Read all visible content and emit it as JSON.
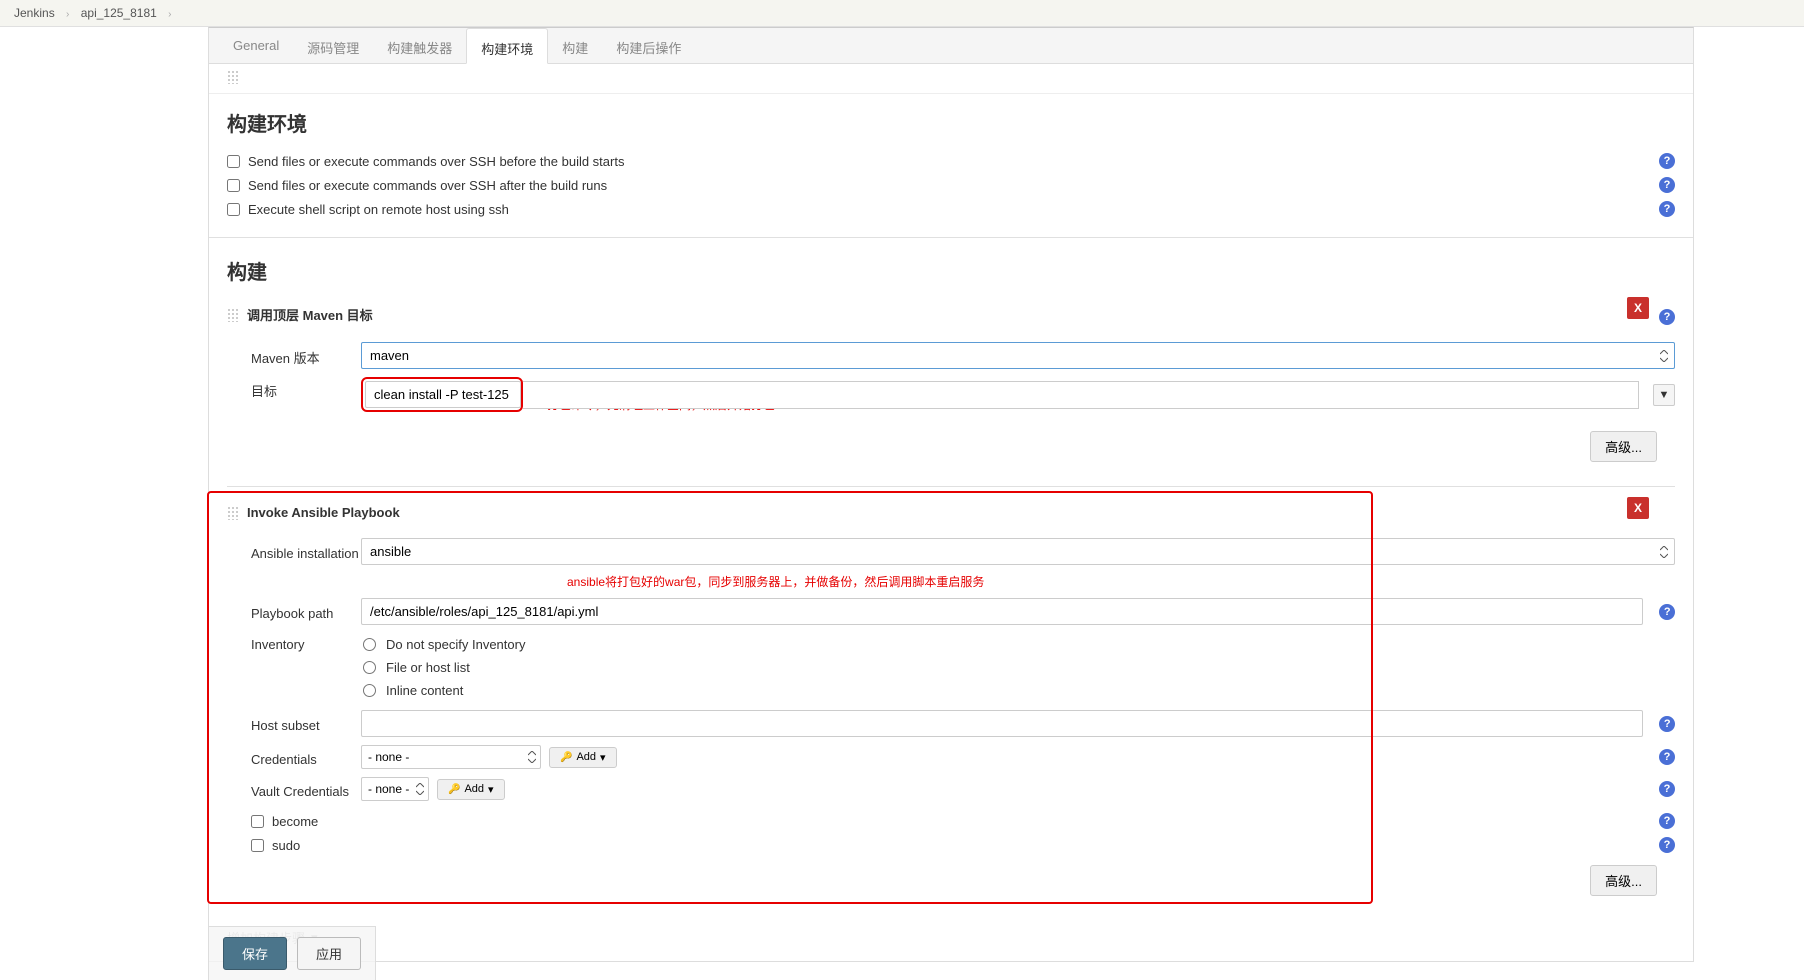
{
  "breadcrumb": {
    "root": "Jenkins",
    "project": "api_125_8181"
  },
  "tabs": {
    "general": "General",
    "scm": "源码管理",
    "triggers": "构建触发器",
    "env": "构建环境",
    "build": "构建",
    "post": "构建后操作"
  },
  "buildEnv": {
    "title": "构建环境",
    "opt1": "Send files or execute commands over SSH before the build starts",
    "opt2": "Send files or execute commands over SSH after the build runs",
    "opt3": "Execute shell script on remote host using ssh"
  },
  "buildSection": {
    "title": "构建"
  },
  "maven": {
    "stepTitle": "调用顶层 Maven 目标",
    "versionLabel": "Maven 版本",
    "versionValue": "maven",
    "goalsLabel": "目标",
    "goalsValue": "clean install -P test-125",
    "annotation": "打包命令，先清理工作空间，然后开始打包",
    "advanced": "高级..."
  },
  "ansible": {
    "stepTitle": "Invoke Ansible Playbook",
    "installLabel": "Ansible installation",
    "installValue": "ansible",
    "annotation": "ansible将打包好的war包，同步到服务器上，并做备份，然后调用脚本重启服务",
    "pathLabel": "Playbook path",
    "pathValue": "/etc/ansible/roles/api_125_8181/api.yml",
    "inventoryLabel": "Inventory",
    "inv1": "Do not specify Inventory",
    "inv2": "File or host list",
    "inv3": "Inline content",
    "hostLabel": "Host subset",
    "credLabel": "Credentials",
    "credValue": "- none -",
    "vaultLabel": "Vault Credentials",
    "vaultValue": "- none -",
    "addBtn": "Add",
    "becomeLabel": "become",
    "sudoLabel": "sudo",
    "advanced": "高级..."
  },
  "ghost": {
    "addStep": "增加构建步骤"
  },
  "footer": {
    "save": "保存",
    "apply": "应用"
  },
  "deleteX": "X"
}
